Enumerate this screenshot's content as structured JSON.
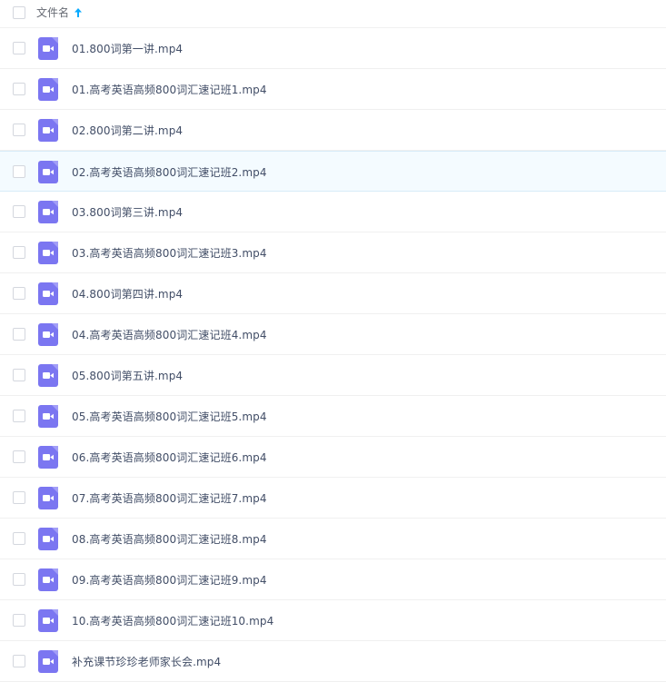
{
  "header": {
    "column_label": "文件名",
    "sort_icon": "arrow-up-icon",
    "accent_color": "#09aaff"
  },
  "file_icon": {
    "name": "video-file-icon",
    "color": "#7b76f1"
  },
  "files": [
    {
      "name": "01.800词第一讲.mp4"
    },
    {
      "name": "01.高考英语高频800词汇速记班1.mp4"
    },
    {
      "name": "02.800词第二讲.mp4"
    },
    {
      "name": "02.高考英语高频800词汇速记班2.mp4"
    },
    {
      "name": "03.800词第三讲.mp4"
    },
    {
      "name": "03.高考英语高频800词汇速记班3.mp4"
    },
    {
      "name": "04.800词第四讲.mp4"
    },
    {
      "name": "04.高考英语高频800词汇速记班4.mp4"
    },
    {
      "name": "05.800词第五讲.mp4"
    },
    {
      "name": "05.高考英语高频800词汇速记班5.mp4"
    },
    {
      "name": "06.高考英语高频800词汇速记班6.mp4"
    },
    {
      "name": "07.高考英语高频800词汇速记班7.mp4"
    },
    {
      "name": "08.高考英语高频800词汇速记班8.mp4"
    },
    {
      "name": "09.高考英语高频800词汇速记班9.mp4"
    },
    {
      "name": "10.高考英语高频800词汇速记班10.mp4"
    },
    {
      "name": "补充课节珍珍老师家长会.mp4"
    }
  ]
}
